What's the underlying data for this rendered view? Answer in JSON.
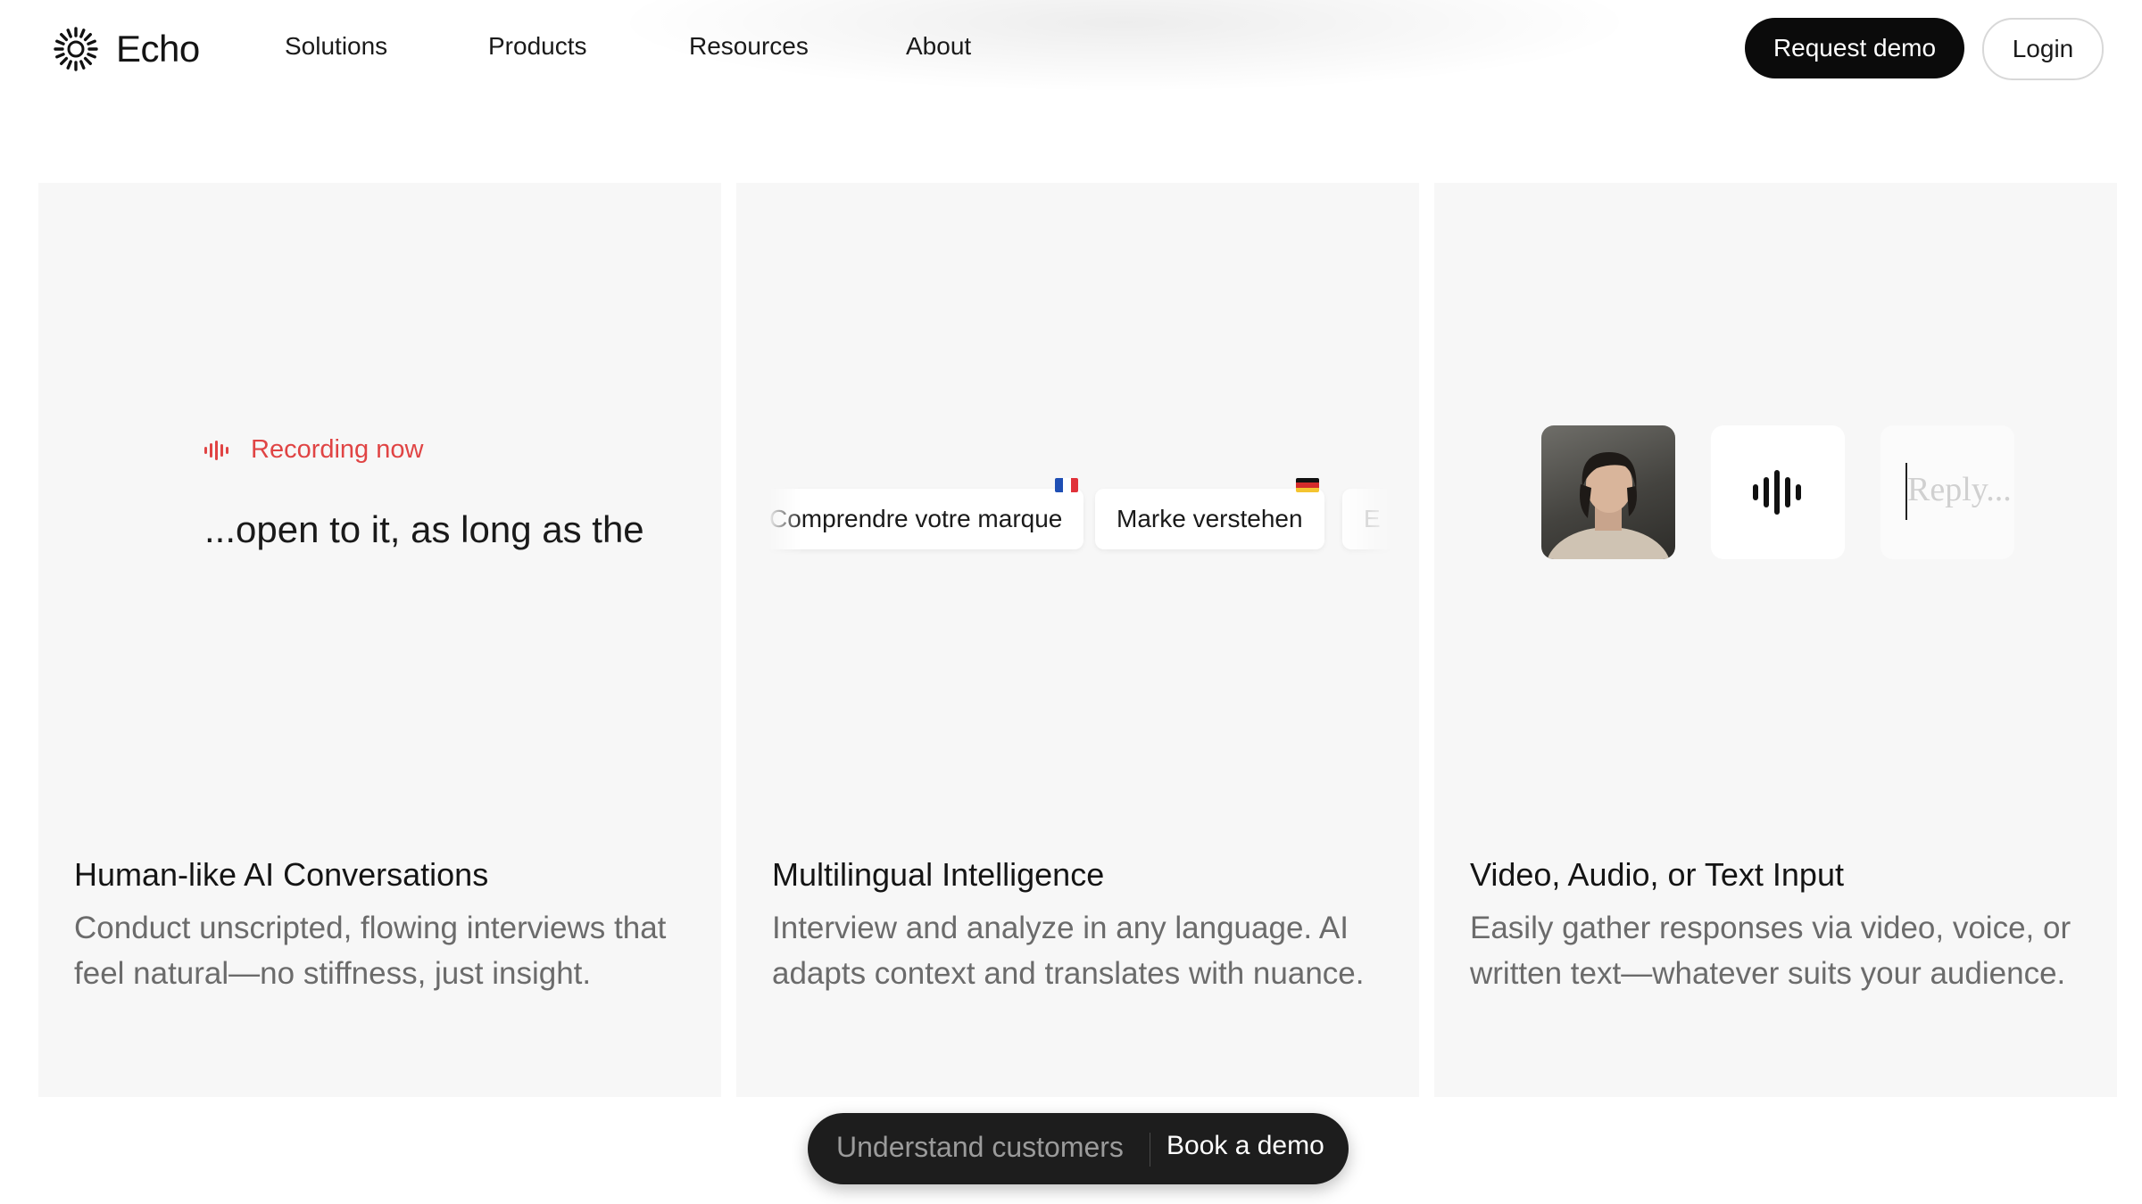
{
  "brand": {
    "name": "Echo",
    "icon": "sunburst-logo-icon"
  },
  "nav": {
    "links": [
      "Solutions",
      "Products",
      "Resources",
      "About"
    ],
    "request_demo": "Request demo",
    "login": "Login"
  },
  "cards": [
    {
      "title": "Human-like AI Conversations",
      "description": "Conduct unscripted, flowing interviews that feel natural—no stiffness, just insight.",
      "recording_label": "Recording now",
      "transcript": "...open to it, as long as the",
      "icon": "waveform-icon",
      "accent": "#e04444"
    },
    {
      "title": "Multilingual Intelligence",
      "description": "Interview and analyze in any language. AI adapts context and translates with nuance.",
      "chips": [
        {
          "text": "Comprendre votre marque",
          "flag": "fr-flag-icon"
        },
        {
          "text": "Marke verstehen",
          "flag": "de-flag-icon"
        },
        {
          "text": "E",
          "flag": ""
        }
      ]
    },
    {
      "title": "Video, Audio, or Text Input",
      "description": "Easily gather responses via video, voice, or written text—whatever suits your audience.",
      "tiles": [
        "video-photo",
        "audio-waveform-icon",
        "text-reply"
      ],
      "reply_placeholder": "Reply..."
    }
  ],
  "cta": {
    "text": "Understand customers",
    "button": "Book a demo"
  }
}
